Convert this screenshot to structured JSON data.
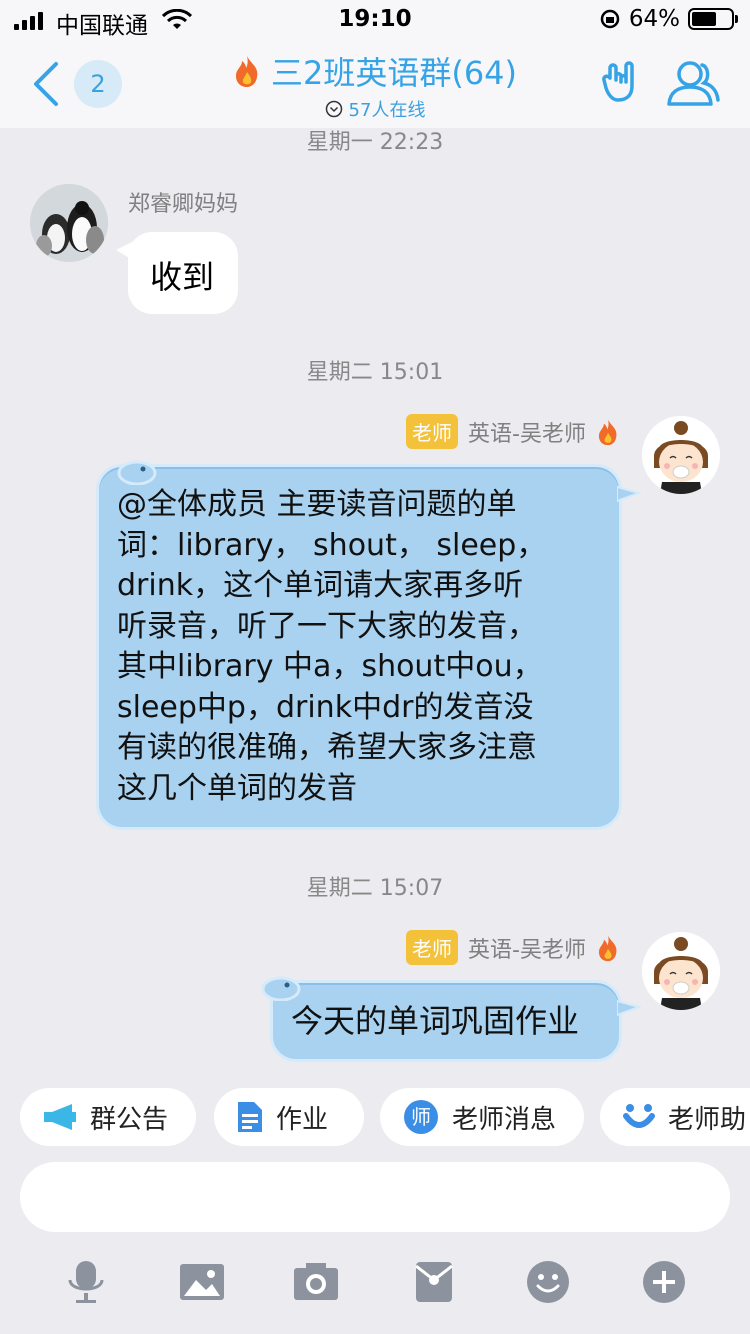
{
  "status": {
    "carrier": "中国联通",
    "time": "19:10",
    "battery": "64%",
    "battery_level": 0.64
  },
  "nav": {
    "back_badge": "2",
    "title": "三2班英语群(64)",
    "online": "57人在线"
  },
  "messages": [
    {
      "time": "星期一 22:23"
    },
    {
      "sender": "郑睿卿妈妈",
      "text": "收到"
    },
    {
      "time": "星期二 15:01"
    },
    {
      "sender_tag": "老师",
      "sender": "英语-吴老师",
      "text": "@全体成员 主要读音问题的单\n词：library， shout， sleep，\ndrink，这个单词请大家再多听\n听录音，听了一下大家的发音，\n其中library 中a，shout中ou，\nsleep中p，drink中dr的发音没\n有读的很准确，希望大家多注意\n这几个单词的发音"
    },
    {
      "time": "星期二 15:07"
    },
    {
      "sender_tag": "老师",
      "sender": "英语-吴老师",
      "text": "今天的单词巩固作业"
    }
  ],
  "quick": {
    "notice": "群公告",
    "homework": "作业",
    "teacher_msg": "老师消息",
    "assistant": "老师助",
    "teacher_msg_icon_char": "师"
  },
  "colors": {
    "accent": "#35a3e6",
    "bubble": "#a8d2f0",
    "tag": "#f3c13a"
  }
}
